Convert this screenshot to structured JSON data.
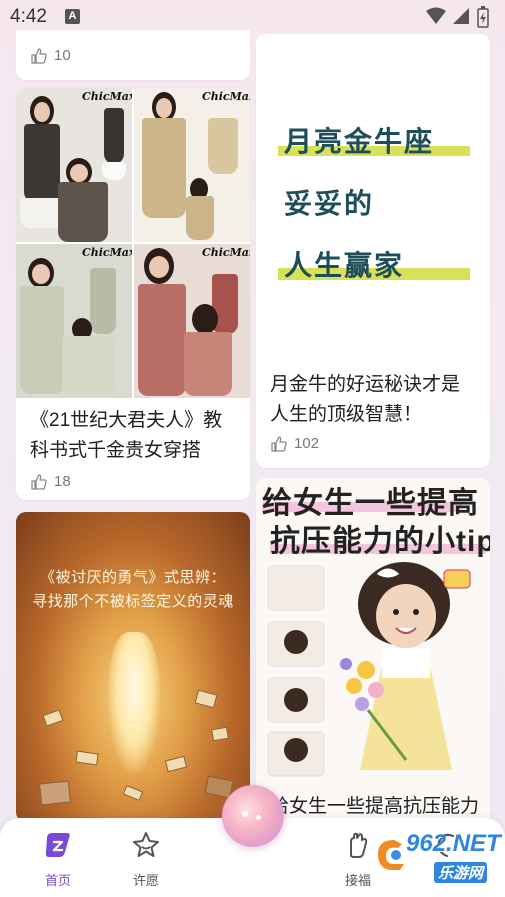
{
  "status_bar": {
    "time": "4:42",
    "app_badge": "A"
  },
  "feed": {
    "top_left_card": {
      "likes": "10"
    },
    "fashion_card": {
      "brand_marks": [
        "ChicMax",
        "ChicMax",
        "ChicMax",
        "ChicMax"
      ],
      "title": "《21世纪大君夫人》教科书式千金贵女穿搭",
      "likes": "18"
    },
    "astro_card": {
      "cover_lines": [
        "月亮金牛座",
        "妥妥的",
        "人生赢家"
      ],
      "title": "月金牛的好运秘诀才是人生的顶级智慧！",
      "likes": "102"
    },
    "courage_card": {
      "cover_lines": [
        "《被讨厌的勇气》式思辨：",
        "寻找那个不被标签定义的灵魂"
      ]
    },
    "tips_card": {
      "cover_lines": [
        "给女生一些提高",
        "抗压能力的小tips"
      ],
      "title_partial": "给女生一些提高抗压能力的小tips"
    }
  },
  "bottom_nav": {
    "items": [
      {
        "label": "首页",
        "icon": "home-icon",
        "active": true
      },
      {
        "label": "许愿",
        "icon": "star-icon",
        "active": false
      },
      {
        "label": "接福",
        "icon": "hand-icon",
        "active": false
      },
      {
        "label": "",
        "icon": "profile-icon",
        "active": false
      }
    ],
    "fab_icon": "orb-icon"
  },
  "watermark": {
    "text": "962.NET",
    "subtext": "乐游网"
  },
  "colors": {
    "accent": "#7b4bd6",
    "astro_text": "#1e4e5a",
    "astro_highlight": "#d9e05a"
  }
}
